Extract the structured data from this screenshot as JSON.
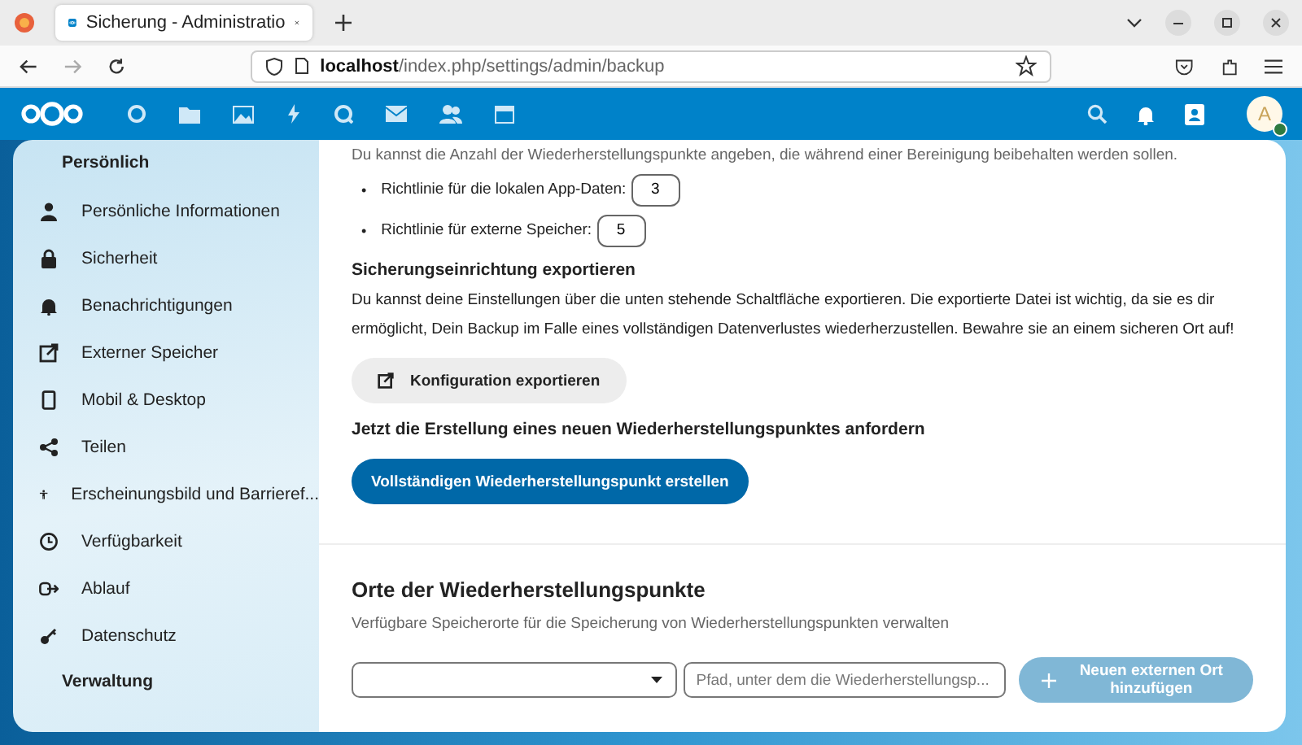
{
  "browser": {
    "tab_title": "Sicherung - Administratio",
    "url": "**localhost**/index.php/settings/admin/backup"
  },
  "header": {
    "avatar_letter": "A"
  },
  "sidebar": {
    "sections": [
      {
        "title": "Persönlich",
        "items": [
          {
            "label": "Persönliche Informationen"
          },
          {
            "label": "Sicherheit"
          },
          {
            "label": "Benachrichtigungen"
          },
          {
            "label": "Externer Speicher"
          },
          {
            "label": "Mobil & Desktop"
          },
          {
            "label": "Teilen"
          },
          {
            "label": "Erscheinungsbild und Barrieref..."
          },
          {
            "label": "Verfügbarkeit"
          },
          {
            "label": "Ablauf"
          },
          {
            "label": "Datenschutz"
          }
        ]
      },
      {
        "title": "Verwaltung"
      }
    ]
  },
  "retention": {
    "intro": "Du kannst die Anzahl der Wiederherstellungspunkte angeben, die während einer Bereinigung beibehalten werden sollen.",
    "policies": [
      {
        "bullet": "•",
        "label": "Richtlinie für die lokalen App-Daten:",
        "value": "3"
      },
      {
        "bullet": "•",
        "label": "Richtlinie für externe Speicher:",
        "value": "5"
      }
    ]
  },
  "export": {
    "heading": "Sicherungseinrichtung exportieren",
    "text": "Du kannst deine Einstellungen über die unten stehende Schaltfläche exportieren. Die exportierte Datei ist wichtig, da sie es dir ermöglicht, Dein Backup im Falle eines vollständigen Datenverlustes wiederherzustellen. Bewahre sie an einem sicheren Ort auf!",
    "button": "Konfiguration exportieren"
  },
  "create": {
    "heading": "Jetzt die Erstellung eines neuen Wiederherstellungspunktes anfordern",
    "button": "Vollständigen Wiederherstellungspunkt erstellen"
  },
  "locations": {
    "heading": "Orte der Wiederherstellungspunkte",
    "description": "Verfügbare Speicherorte für die Speicherung von Wiederherstellungspunkten verwalten",
    "path_placeholder": "Pfad, unter dem die Wiederherstellungsp...",
    "add_button": {
      "label": "Neuen externen Ort hinzufügen",
      "disabled": true
    }
  }
}
